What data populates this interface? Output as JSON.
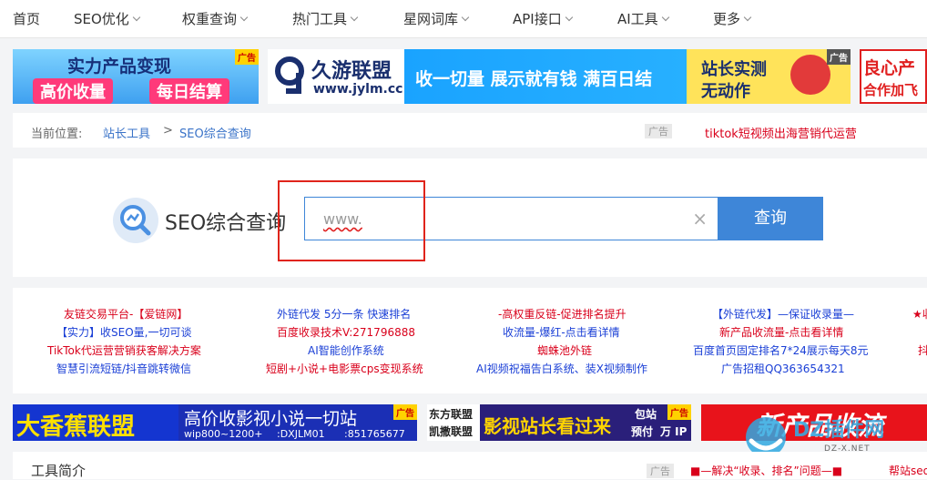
{
  "nav": {
    "items": [
      {
        "label": "首页",
        "dropdown": false
      },
      {
        "label": "SEO优化",
        "dropdown": true
      },
      {
        "label": "权重查询",
        "dropdown": true
      },
      {
        "label": "热门工具",
        "dropdown": true
      },
      {
        "label": "星网词库",
        "dropdown": true
      },
      {
        "label": "API接口",
        "dropdown": true
      },
      {
        "label": "AI工具",
        "dropdown": true
      },
      {
        "label": "更多",
        "dropdown": true
      }
    ]
  },
  "banners_top": {
    "b1": {
      "line1": "实力产品变现",
      "line2a": "高价收量",
      "line2b": "每日结算",
      "tag": "广告"
    },
    "b2": {
      "brand": "久游联盟",
      "url": "www.jylm.cc",
      "slogan": "收一切量 展示就有钱 满百日结",
      "right1": "站长实测",
      "right2": "无动作",
      "tag": "广告"
    },
    "b3": {
      "line1": "良心产",
      "line2": "合作加飞"
    }
  },
  "breadcrumb": {
    "prefix": "当前位置:",
    "home": "站长工具",
    "sep": ">",
    "current": "SEO综合查询",
    "ad_tag": "广告",
    "ad_text": "tiktok短视频出海营销代运营"
  },
  "search": {
    "title": "SEO综合查询",
    "placeholder": "www.",
    "button": "查询",
    "clear": "×"
  },
  "text_links": {
    "col1": [
      "友链交易平台-【爱链网】",
      "【实力】收SEO量,一切可谈",
      "TikTok代运营营销获客解决方案",
      "智慧引流短链/抖音跳转微信"
    ],
    "col2": [
      "外链代发 5分一条 快速排名",
      "百度收录技术V:271796888",
      "AI智能创作系统",
      "短剧+小说+电影票cps变现系统"
    ],
    "col3": [
      "-高权重反链-促进排名提升",
      "收流量-爆红-点击看详情",
      "蜘蛛池外链",
      "AI视频祝福告白系统、装X视频制作"
    ],
    "col4": [
      "【外链代发】—保证收录量—",
      "新产品收流量-点击看详情",
      "百度首页固定排名7*24展示每天8元",
      "广告招租QQ363654321"
    ],
    "col5": [
      "★收",
      "",
      "抖",
      ""
    ]
  },
  "banners_bottom": {
    "b1": {
      "big": "大香蕉联盟",
      "line1": "高价收影视小说一切站",
      "line2a": "wip800~1200+",
      "line2b": ":DXJLM01",
      "line2c": ":851765677",
      "tag": "广告"
    },
    "b2": {
      "left1": "东方联盟",
      "left2": "凯撒联盟",
      "main": "影视站长看过来",
      "r1": "包站",
      "r2": "预付",
      "r3": "万 IP",
      "tag": "广告"
    },
    "b3": {
      "text": "新产品收流"
    }
  },
  "intro": {
    "title": "工具简介",
    "ad_tag": "广告",
    "ad_text": "■—解决“收录、排名”问题—■",
    "right_text": "帮站seo"
  },
  "watermark": {
    "text": "DZ插件网",
    "sub": "DZ-X.NET"
  },
  "colors": {
    "link_red": "#d9001b",
    "link_blue": "#1a3fd6",
    "button_blue": "#3e86d8",
    "highlight_box": "#e0241b"
  }
}
